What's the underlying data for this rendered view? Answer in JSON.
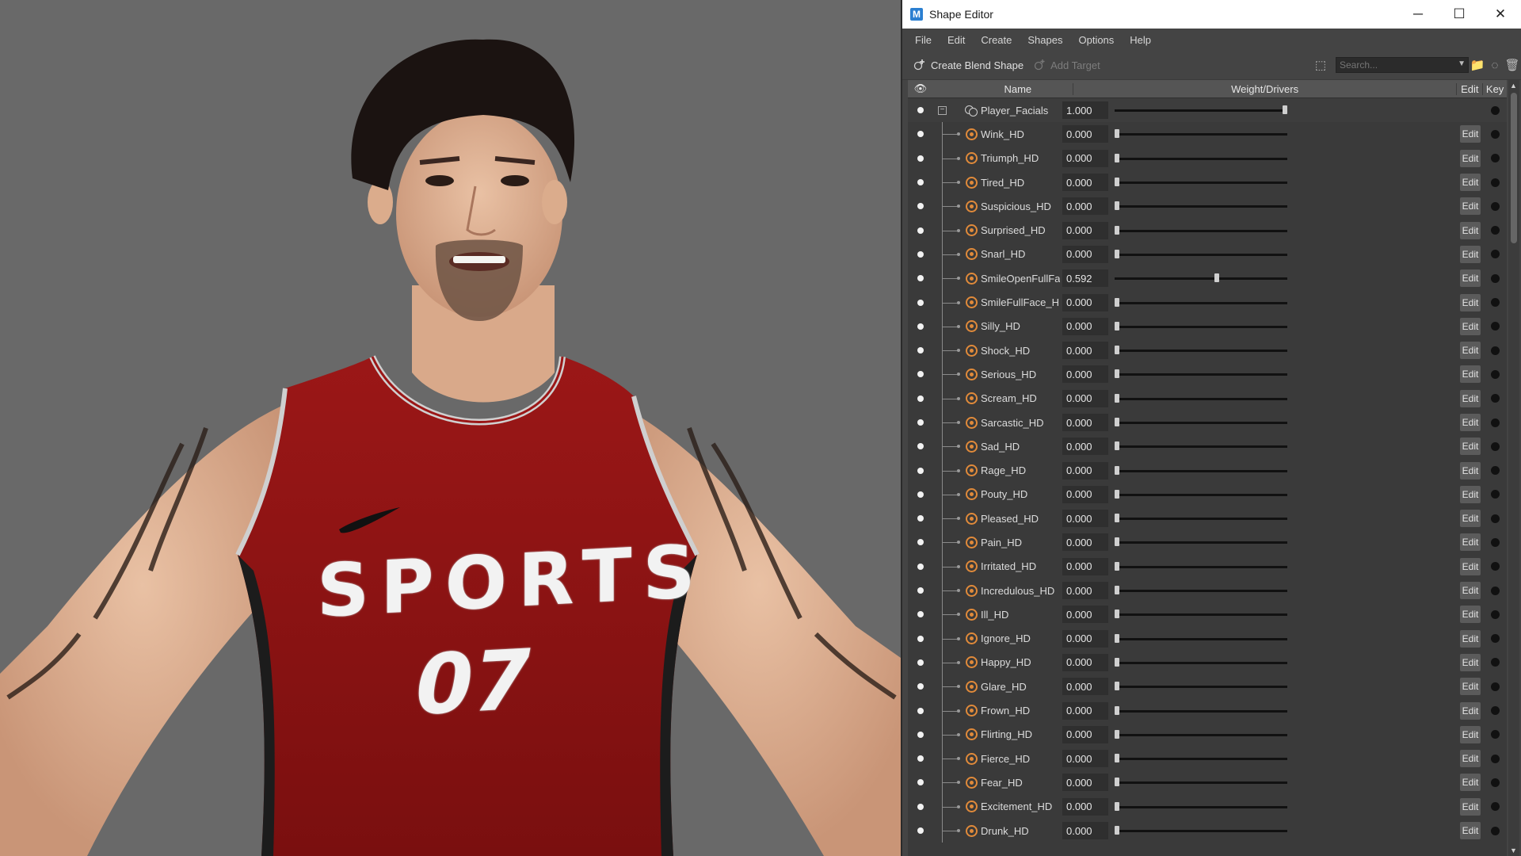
{
  "viewport": {
    "jersey_word": "SPORTS",
    "jersey_number": "07"
  },
  "window": {
    "title": "Shape Editor",
    "app_icon_letter": "M",
    "minimize": "─",
    "maximize": "☐",
    "close": "✕"
  },
  "menu": [
    "File",
    "Edit",
    "Create",
    "Shapes",
    "Options",
    "Help"
  ],
  "toolbar": {
    "create_blend_shape": "Create Blend Shape",
    "add_target": "Add Target",
    "search_placeholder": "Search..."
  },
  "table": {
    "columns": {
      "name": "Name",
      "weight": "Weight/Drivers",
      "edit": "Edit",
      "key": "Key"
    },
    "edit_label": "Edit",
    "parent": {
      "name": "Player_Facials",
      "value": "1.000",
      "weight": 1.0
    },
    "targets": [
      {
        "name": "Wink_HD",
        "value": "0.000",
        "weight": 0.0
      },
      {
        "name": "Triumph_HD",
        "value": "0.000",
        "weight": 0.0
      },
      {
        "name": "Tired_HD",
        "value": "0.000",
        "weight": 0.0
      },
      {
        "name": "Suspicious_HD",
        "value": "0.000",
        "weight": 0.0
      },
      {
        "name": "Surprised_HD",
        "value": "0.000",
        "weight": 0.0
      },
      {
        "name": "Snarl_HD",
        "value": "0.000",
        "weight": 0.0
      },
      {
        "name": "SmileOpenFullFa",
        "value": "0.592",
        "weight": 0.592
      },
      {
        "name": "SmileFullFace_H",
        "value": "0.000",
        "weight": 0.0
      },
      {
        "name": "Silly_HD",
        "value": "0.000",
        "weight": 0.0
      },
      {
        "name": "Shock_HD",
        "value": "0.000",
        "weight": 0.0
      },
      {
        "name": "Serious_HD",
        "value": "0.000",
        "weight": 0.0
      },
      {
        "name": "Scream_HD",
        "value": "0.000",
        "weight": 0.0
      },
      {
        "name": "Sarcastic_HD",
        "value": "0.000",
        "weight": 0.0
      },
      {
        "name": "Sad_HD",
        "value": "0.000",
        "weight": 0.0
      },
      {
        "name": "Rage_HD",
        "value": "0.000",
        "weight": 0.0
      },
      {
        "name": "Pouty_HD",
        "value": "0.000",
        "weight": 0.0
      },
      {
        "name": "Pleased_HD",
        "value": "0.000",
        "weight": 0.0
      },
      {
        "name": "Pain_HD",
        "value": "0.000",
        "weight": 0.0
      },
      {
        "name": "Irritated_HD",
        "value": "0.000",
        "weight": 0.0
      },
      {
        "name": "Incredulous_HD",
        "value": "0.000",
        "weight": 0.0
      },
      {
        "name": "Ill_HD",
        "value": "0.000",
        "weight": 0.0
      },
      {
        "name": "Ignore_HD",
        "value": "0.000",
        "weight": 0.0
      },
      {
        "name": "Happy_HD",
        "value": "0.000",
        "weight": 0.0
      },
      {
        "name": "Glare_HD",
        "value": "0.000",
        "weight": 0.0
      },
      {
        "name": "Frown_HD",
        "value": "0.000",
        "weight": 0.0
      },
      {
        "name": "Flirting_HD",
        "value": "0.000",
        "weight": 0.0
      },
      {
        "name": "Fierce_HD",
        "value": "0.000",
        "weight": 0.0
      },
      {
        "name": "Fear_HD",
        "value": "0.000",
        "weight": 0.0
      },
      {
        "name": "Excitement_HD",
        "value": "0.000",
        "weight": 0.0
      },
      {
        "name": "Drunk_HD",
        "value": "0.000",
        "weight": 0.0
      }
    ]
  },
  "colors": {
    "target_icon": "#e08a3a",
    "jersey": "#8e1414",
    "viewport_bg": "#696969"
  }
}
